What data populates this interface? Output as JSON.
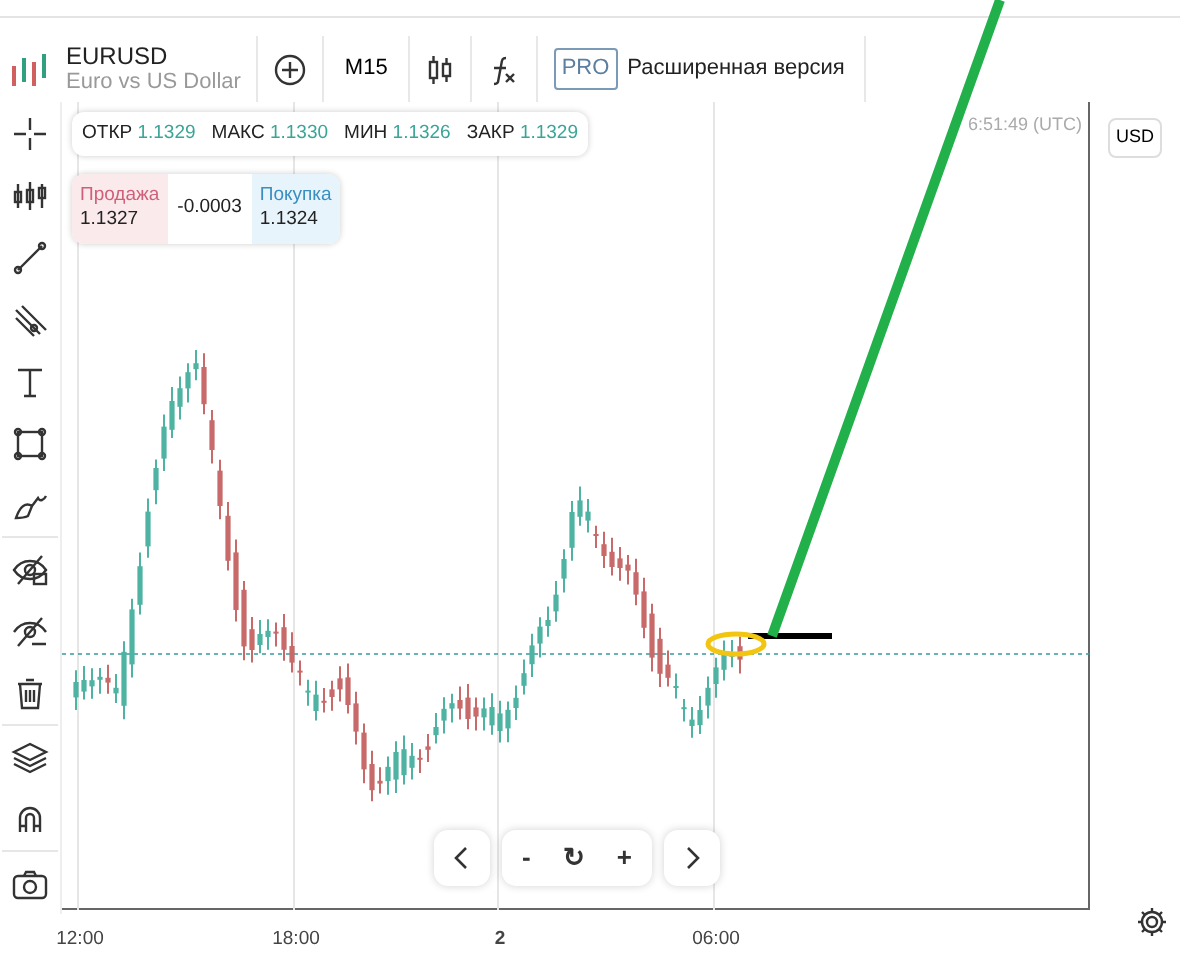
{
  "header": {
    "symbol": "EURUSD",
    "description": "Euro vs US Dollar",
    "interval": "M15",
    "pro_badge": "PRO",
    "pro_label": "Расширенная версия"
  },
  "ohlc": [
    {
      "label": "ОТКР",
      "value": "1.1329"
    },
    {
      "label": "МАКС",
      "value": "1.1330"
    },
    {
      "label": "МИН",
      "value": "1.1326"
    },
    {
      "label": "ЗАКР",
      "value": "1.1329"
    }
  ],
  "quote": {
    "sell_label": "Продажа",
    "sell": "1.1327",
    "spread": "-0.0003",
    "buy_label": "Покупка",
    "buy": "1.1324"
  },
  "clock": "6:51:49 (UTC)",
  "currency": "USD",
  "time_axis": [
    {
      "label": "12:00",
      "bold": false
    },
    {
      "label": "18:00",
      "bold": false
    },
    {
      "label": "2",
      "bold": true
    },
    {
      "label": "06:00",
      "bold": false
    }
  ],
  "nav": {
    "zoom_out": "-",
    "reset": "↻",
    "zoom_in": "+"
  }
}
